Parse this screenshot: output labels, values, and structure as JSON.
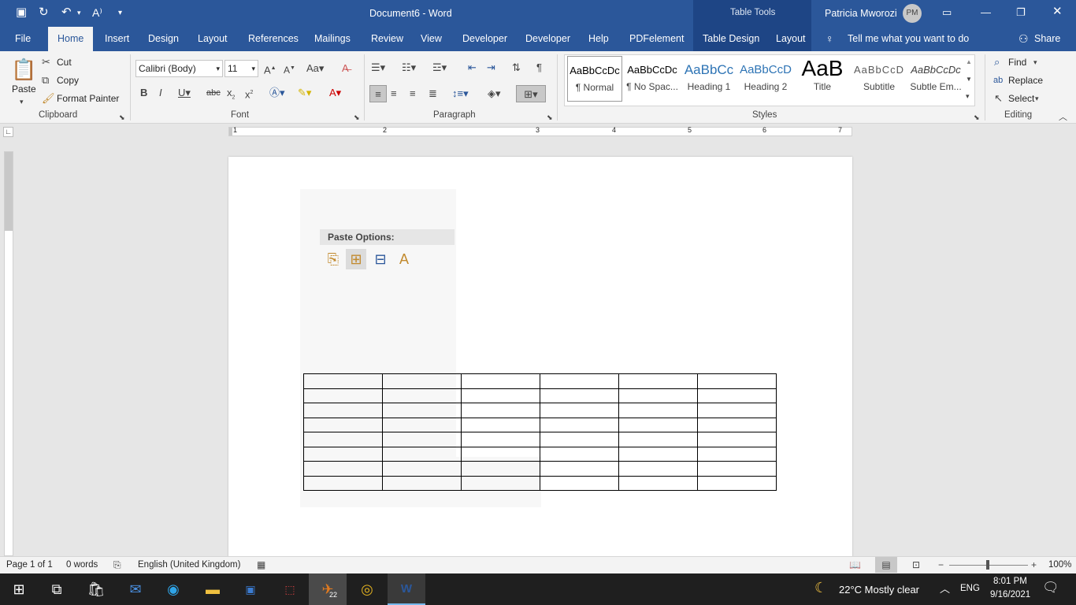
{
  "titlebar": {
    "doc_title": "Document6  -  Word",
    "context_title": "Table Tools",
    "user_name": "Patricia Mworozi",
    "user_initials": "PM"
  },
  "tabs": [
    "File",
    "Home",
    "Insert",
    "Design",
    "Layout",
    "References",
    "Mailings",
    "Review",
    "View",
    "Developer",
    "Developer",
    "Help",
    "PDFelement",
    "Table Design",
    "Layout"
  ],
  "tell_me": "Tell me what you want to do",
  "share": "Share",
  "clipboard": {
    "paste": "Paste",
    "cut": "Cut",
    "copy": "Copy",
    "format_painter": "Format Painter",
    "label": "Clipboard"
  },
  "font": {
    "name": "Calibri (Body)",
    "size": "11",
    "label": "Font"
  },
  "paragraph": {
    "label": "Paragraph"
  },
  "styles": {
    "label": "Styles",
    "items": [
      {
        "sample": "AaBbCcDc",
        "name": "¶ Normal"
      },
      {
        "sample": "AaBbCcDc",
        "name": "¶ No Spac..."
      },
      {
        "sample": "AaBbCc",
        "name": "Heading 1"
      },
      {
        "sample": "AaBbCcD",
        "name": "Heading 2"
      },
      {
        "sample": "AaB",
        "name": "Title"
      },
      {
        "sample": "AaBbCcD",
        "name": "Subtitle"
      },
      {
        "sample": "AaBbCcDc",
        "name": "Subtle Em..."
      }
    ]
  },
  "editing": {
    "find": "Find",
    "replace": "Replace",
    "select": "Select",
    "label": "Editing"
  },
  "ruler_numbers": [
    "1",
    "2",
    "3",
    "4",
    "5",
    "6",
    "7"
  ],
  "paste_options": {
    "header": "Paste Options:"
  },
  "status": {
    "page": "Page 1 of 1",
    "words": "0 words",
    "language": "English (United Kingdom)",
    "zoom": "100%"
  },
  "taskbar": {
    "weather": "22°C  Mostly clear",
    "lang": "ENG",
    "time": "8:01 PM",
    "date": "9/16/2021",
    "badge": "22"
  }
}
